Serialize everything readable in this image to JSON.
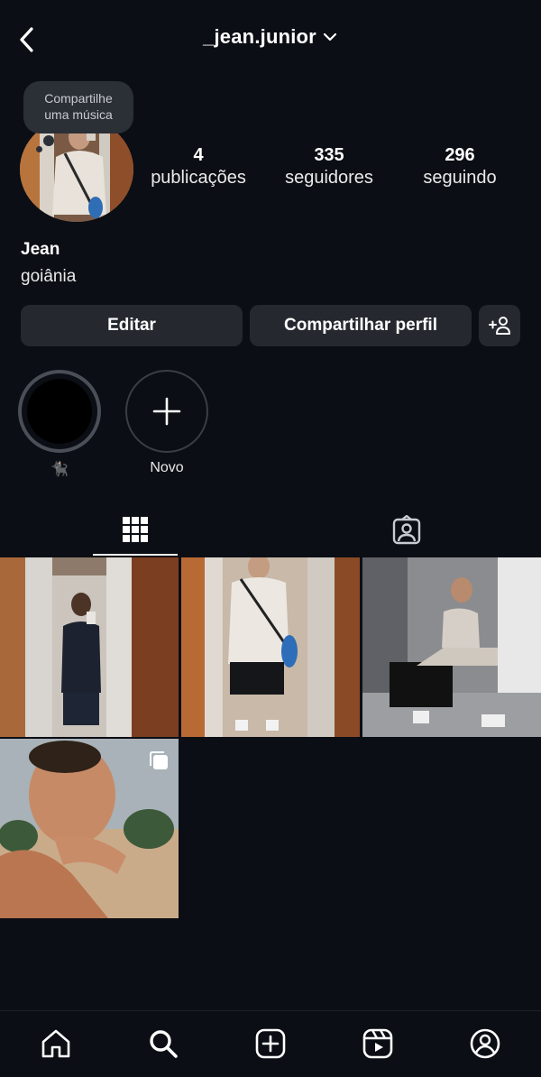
{
  "header": {
    "username": "_jean.junior"
  },
  "note": {
    "text": "Compartilhe uma música"
  },
  "stats": [
    {
      "value": "4",
      "label": "publicações"
    },
    {
      "value": "335",
      "label": "seguidores"
    },
    {
      "value": "296",
      "label": "seguindo"
    }
  ],
  "profile": {
    "name": "Jean",
    "bio": "goiânia"
  },
  "buttons": {
    "edit": "Editar",
    "share": "Compartilhar perfil"
  },
  "highlights": [
    {
      "label": "🐈‍⬛"
    },
    {
      "label": "Novo"
    }
  ],
  "icons": {
    "back": "chevron-left-icon",
    "dropdown": "chevron-down-icon",
    "add_person": "add-person-icon",
    "grid": "grid-icon",
    "tagged": "tagged-person-icon",
    "carousel": "carousel-icon",
    "home": "home-icon",
    "search": "search-icon",
    "create": "create-icon",
    "reels": "reels-icon",
    "profile": "profile-icon"
  },
  "colors": {
    "background": "#0b0e14",
    "button": "#25292f",
    "note": "#2b2f36"
  }
}
